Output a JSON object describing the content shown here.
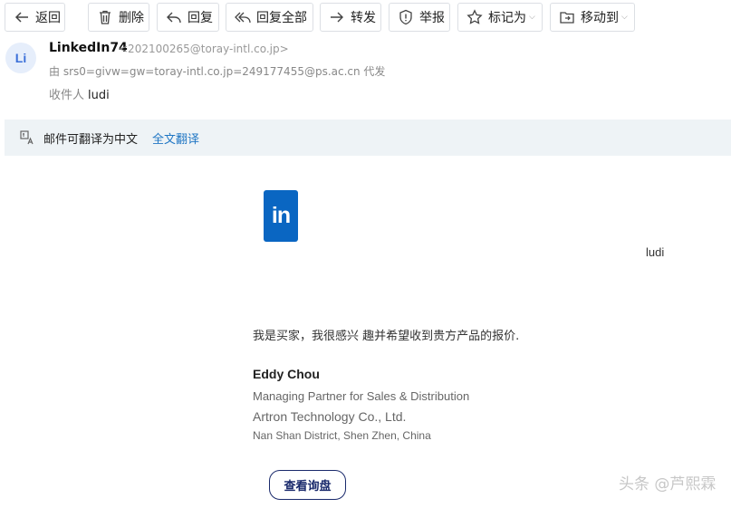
{
  "toolbar": {
    "back": "返回",
    "delete": "删除",
    "reply": "回复",
    "reply_all": "回复全部",
    "forward": "转发",
    "report": "举报",
    "mark_as": "标记为",
    "move_to": "移动到"
  },
  "header": {
    "avatar_initials": "Li",
    "sender_name": "LinkedIn74",
    "sender_email": "<202100265@toray-intl.co.jp>",
    "via": "由 srs0=givw=gw=toray-intl.co.jp=249177455@ps.ac.cn 代发",
    "recipient_label": "收件人",
    "recipient_name": "ludi"
  },
  "translate": {
    "notice": "邮件可翻译为中文",
    "link": "全文翻译"
  },
  "body": {
    "logo_text": "in",
    "greeting_name": "ludi",
    "message": "我是买家，我很感兴 趣并希望收到贵方产品的报价.",
    "signature_name": "Eddy Chou",
    "signature_title": "Managing Partner for Sales & Distribution",
    "signature_company": "Artron Technology Co., Ltd.",
    "signature_address": "Nan Shan District, Shen Zhen, China",
    "inquiry_button": "查看询盘"
  },
  "watermark": "头条 @芦熙霖",
  "colors": {
    "linkedin_blue": "#0a66c2",
    "link_blue": "#1f76c4",
    "button_navy": "#1a2a6c",
    "translate_bar_bg": "#eef3f6"
  }
}
